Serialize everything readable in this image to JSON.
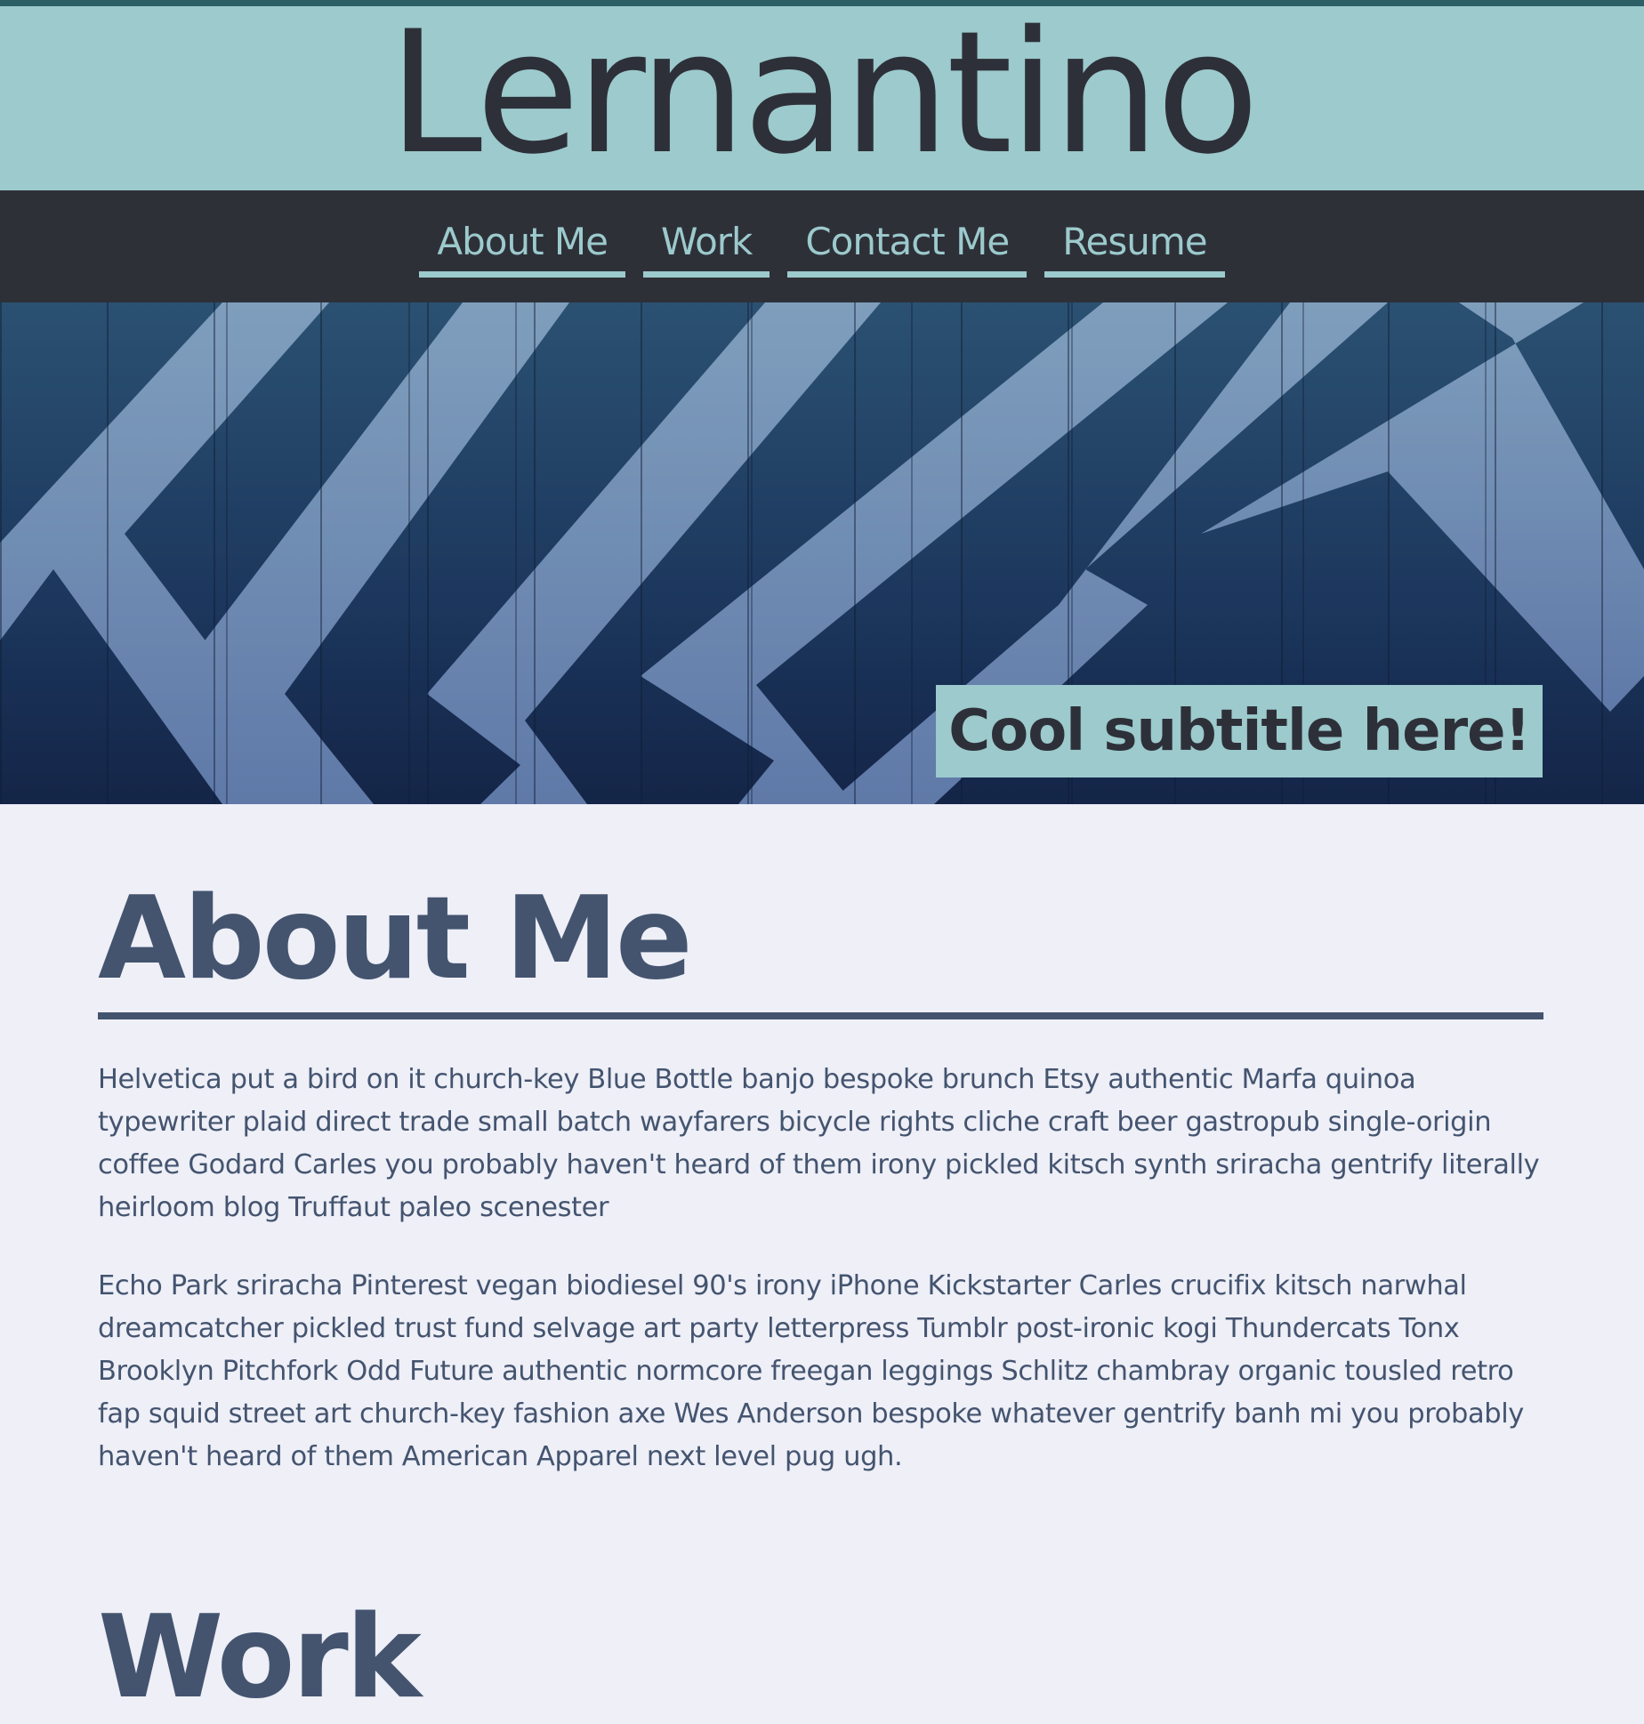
{
  "header": {
    "title": "Lernantino"
  },
  "nav": {
    "items": [
      {
        "label": "About Me"
      },
      {
        "label": "Work"
      },
      {
        "label": "Contact Me"
      },
      {
        "label": "Resume"
      }
    ]
  },
  "hero": {
    "subtitle": "Cool subtitle here!"
  },
  "about": {
    "heading": "About Me",
    "paragraphs": [
      "Helvetica put a bird on it church-key Blue Bottle banjo bespoke brunch Etsy authentic Marfa quinoa typewriter plaid direct trade small batch wayfarers bicycle rights cliche craft beer gastropub single-origin coffee Godard Carles you probably haven't heard of them irony pickled kitsch synth sriracha gentrify literally heirloom blog Truffaut paleo scenester",
      "Echo Park sriracha Pinterest vegan biodiesel 90's irony iPhone Kickstarter Carles crucifix kitsch narwhal dreamcatcher pickled trust fund selvage art party letterpress Tumblr post-ironic kogi Thundercats Tonx Brooklyn Pitchfork Odd Future authentic normcore freegan leggings Schlitz chambray organic tousled retro fap squid street art church-key fashion axe Wes Anderson bespoke whatever gentrify banh mi you probably haven't heard of them American Apparel next level pug ugh."
    ]
  },
  "work": {
    "heading": "Work"
  },
  "colors": {
    "header_bg": "#9ccacd",
    "nav_bg": "#2e3038",
    "accent": "#9ccacd",
    "text_dark": "#2e3039",
    "heading": "#44546f",
    "page_bg": "#eeeff7"
  }
}
